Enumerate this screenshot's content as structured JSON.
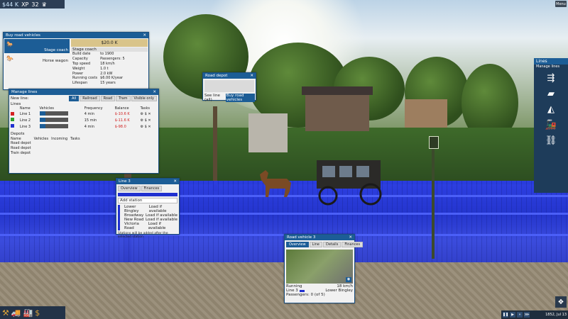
{
  "hud": {
    "money": "$44 K",
    "xp_label": "XP",
    "xp_value": "32",
    "menu_label": "Menu"
  },
  "buy_road_vehicles": {
    "title": "Buy road vehicles",
    "vehicles": [
      "Stage coach",
      "Horse wagon"
    ],
    "price": "$20.0 K",
    "selected_name": "Stage coach",
    "specs": [
      {
        "label": "Build date",
        "value": "to 1900"
      },
      {
        "label": "Capacity",
        "value": "Passengers: 5"
      },
      {
        "label": "Top speed",
        "value": "18 km/h"
      },
      {
        "label": "Weight",
        "value": "1.0 t"
      },
      {
        "label": "Power",
        "value": "2.0 kW"
      },
      {
        "label": "Running costs",
        "value": "$6.00 K/year"
      },
      {
        "label": "Lifespan",
        "value": "15 years"
      }
    ]
  },
  "road_depot": {
    "title": "Road depot",
    "btn_see_list": "See line (all)",
    "btn_buy": "Buy road vehicles"
  },
  "manage_lines": {
    "title": "Manage lines",
    "new_line_label": "New line:",
    "filters": [
      "All",
      "Railroad",
      "Road",
      "Tram",
      "Visible only"
    ],
    "lines_label": "Lines",
    "columns": [
      "Name",
      "Vehicles",
      "Frequency",
      "Balance",
      "Tasks"
    ],
    "lines": [
      {
        "name": "Line 1",
        "color": "#d42222",
        "frequency": "4 min",
        "balance": "$-10.6 K"
      },
      {
        "name": "Line 2",
        "color": "#2ea12e",
        "frequency": "15 min",
        "balance": "$-11.6 K"
      },
      {
        "name": "Line 3",
        "color": "#2030d0",
        "frequency": "4 min",
        "balance": "$-98.0"
      }
    ],
    "depots_label": "Depots",
    "depot_columns": [
      "Name",
      "Vehicles",
      "Incoming",
      "Tasks"
    ],
    "depots": [
      "Road depot",
      "Road depot",
      "Train depot"
    ]
  },
  "line3": {
    "title": "Line 3",
    "tabs": [
      "Overview",
      "Finances"
    ],
    "add_station": "Add station",
    "stations": [
      {
        "name": "Lower Bingley",
        "action": "Load if available"
      },
      {
        "name": "Broadway",
        "action": "Load if available"
      },
      {
        "name": "New Road",
        "action": "Load if available"
      },
      {
        "name": "Victoria Road",
        "action": "Load if available"
      }
    ],
    "note": "Stations will be added after the selected station"
  },
  "road_vehicle": {
    "title": "Road vehicle 3",
    "tabs": [
      "Overview",
      "Line",
      "Details",
      "Finances"
    ],
    "status": "Running",
    "speed": "18 km/h",
    "line": "Line 3",
    "destination": "Lower Bingley",
    "passengers": "Passengers: 0 (of 5)"
  },
  "sidebar": {
    "title": "Lines",
    "subtitle": "Manage lines"
  },
  "timebar": {
    "date": "1852, Jul 13"
  }
}
